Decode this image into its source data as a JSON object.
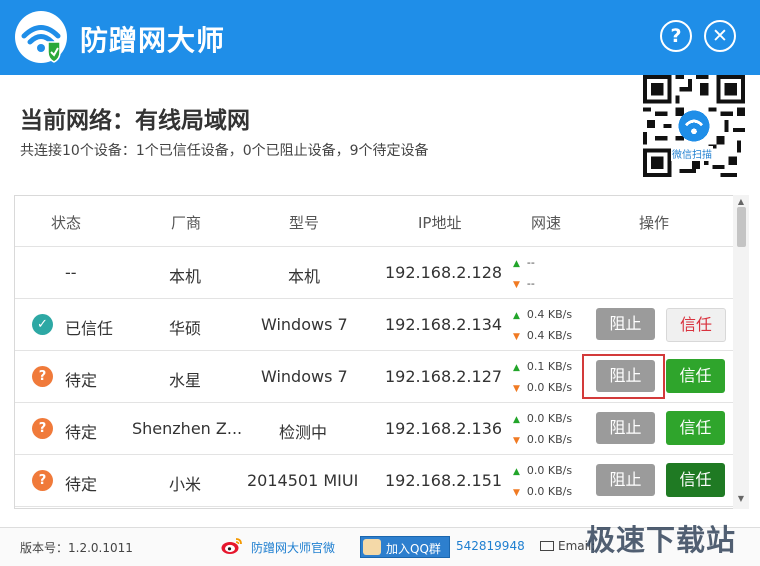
{
  "app": {
    "title": "防蹭网大师",
    "help_glyph": "?",
    "close_glyph": "✕"
  },
  "network": {
    "title": "当前网络：有线局域网",
    "summary": "共连接10个设备：1个已信任设备，0个已阻止设备，9个待定设备",
    "qr_label": "微信扫描"
  },
  "table": {
    "headers": [
      "状态",
      "厂商",
      "型号",
      "IP地址",
      "网速",
      "操作"
    ],
    "rows": [
      {
        "status": "--",
        "status_type": "self",
        "vendor": "本机",
        "model": "本机",
        "ip": "192.168.2.128",
        "up": "--",
        "down": "--",
        "actions": false
      },
      {
        "status": "已信任",
        "status_type": "trusted",
        "vendor": "华硕",
        "model": "Windows 7",
        "ip": "192.168.2.134",
        "up": "0.4 KB/s",
        "down": "0.4 KB/s",
        "actions": true,
        "block_label": "阻止",
        "trust_label": "信任"
      },
      {
        "status": "待定",
        "status_type": "pending",
        "vendor": "水星",
        "model": "Windows 7",
        "ip": "192.168.2.127",
        "up": "0.1 KB/s",
        "down": "0.0 KB/s",
        "actions": true,
        "block_label": "阻止",
        "trust_label": "信任"
      },
      {
        "status": "待定",
        "status_type": "pending",
        "vendor": "Shenzhen Z...",
        "model": "检测中",
        "ip": "192.168.2.136",
        "up": "0.0 KB/s",
        "down": "0.0 KB/s",
        "actions": true,
        "block_label": "阻止",
        "trust_label": "信任"
      },
      {
        "status": "待定",
        "status_type": "pending",
        "vendor": "小米",
        "model": "2014501 MIUI",
        "ip": "192.168.2.151",
        "up": "0.0 KB/s",
        "down": "0.0 KB/s",
        "actions": true,
        "block_label": "阻止",
        "trust_label": "信任"
      }
    ]
  },
  "footer": {
    "version": "版本号：1.2.0.1011",
    "weibo": "防蹭网大师官微",
    "qq_button": "加入QQ群",
    "qq_number": "542819948",
    "email_label": "Email:",
    "watermark": "极速下载站"
  },
  "colors": {
    "titlebar": "#1f8ee8",
    "trusted": "#2da8a4",
    "pending": "#f07a3a",
    "trust_button": "#2fa52c",
    "block_button": "#9b9b9b",
    "highlight": "#d33a3a"
  }
}
